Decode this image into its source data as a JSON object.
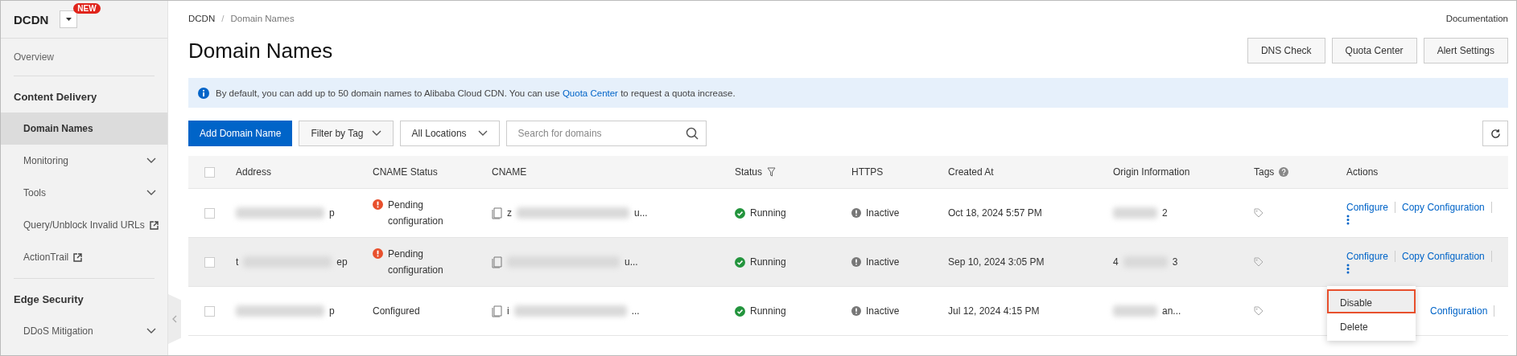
{
  "sidebar": {
    "title": "DCDN",
    "badge": "NEW",
    "sections": [
      {
        "items": [
          {
            "label": "Overview",
            "selected": false
          }
        ]
      },
      {
        "heading": "Content Delivery",
        "items": [
          {
            "label": "Domain Names",
            "selected": true
          },
          {
            "label": "Monitoring",
            "selected": false,
            "expanded": false
          },
          {
            "label": "Tools",
            "selected": false,
            "expanded": false
          },
          {
            "label": "Query/Unblock Invalid URLs",
            "selected": false,
            "external": true
          },
          {
            "label": "ActionTrail",
            "selected": false,
            "external": true
          }
        ]
      },
      {
        "heading": "Edge Security",
        "items": [
          {
            "label": "DDoS Mitigation",
            "selected": false,
            "expanded": false
          }
        ]
      }
    ]
  },
  "breadcrumb": [
    "DCDN",
    "Domain Names"
  ],
  "breadcrumb_separator": "/",
  "documentation_link": "Documentation",
  "title": "Domain Names",
  "header_buttons": [
    "DNS Check",
    "Quota Center",
    "Alert Settings"
  ],
  "notice": {
    "before": "By default, you can add up to 50 domain names to Alibaba Cloud CDN. You can use ",
    "link": "Quota Center",
    "after": " to request a quota increase."
  },
  "toolbar": {
    "add_button": "Add Domain Name",
    "tag_filter": "Filter by Tag",
    "location": "All Locations",
    "search": {
      "placeholder": "Search for domains"
    }
  },
  "table": {
    "all_checked": false,
    "columns": [
      "Address",
      "CNAME Status",
      "CNAME",
      "Status",
      "HTTPS",
      "Created At",
      "Origin Information",
      "Tags",
      "Actions"
    ],
    "rows": [
      {
        "checked": false,
        "hovered": false,
        "address": {
          "suffix": "p"
        },
        "cname_status": {
          "kind": "pending",
          "text": "Pending configuration"
        },
        "cname": {
          "prefix": "z",
          "suffix": "u..."
        },
        "status": {
          "kind": "running",
          "text": "Running"
        },
        "https": {
          "kind": "inactive",
          "text": "Inactive"
        },
        "created_at": "Oct 18, 2024 5:57 PM",
        "origin": {
          "suffix": "2"
        },
        "actions": [
          {
            "label": "Configure",
            "kind": "full"
          },
          {
            "label": "Copy Configuration",
            "kind": "full"
          }
        ],
        "more": true
      },
      {
        "checked": false,
        "hovered": true,
        "address": {
          "prefix": "t",
          "suffix": "ep"
        },
        "cname_status": {
          "kind": "pending",
          "text": "Pending configuration"
        },
        "cname": {
          "suffix": "u..."
        },
        "status": {
          "kind": "running",
          "text": "Running"
        },
        "https": {
          "kind": "inactive",
          "text": "Inactive"
        },
        "created_at": "Sep 10, 2024 3:05 PM",
        "origin": {
          "prefix": "4",
          "suffix": "3"
        },
        "actions": [
          {
            "label": "Configure",
            "kind": "full"
          },
          {
            "label": "Copy Configuration",
            "kind": "full"
          }
        ],
        "more": true
      },
      {
        "checked": false,
        "hovered": false,
        "address": {
          "suffix": "p"
        },
        "cname_status": {
          "kind": "configured",
          "text": "Configured"
        },
        "cname": {
          "prefix": "i",
          "suffix": "..."
        },
        "status": {
          "kind": "running",
          "text": "Running"
        },
        "https": {
          "kind": "inactive",
          "text": "Inactive"
        },
        "created_at": "Jul 12, 2024 4:15 PM",
        "origin": {
          "suffix": "an..."
        },
        "actions": [
          {
            "label": "Configuration",
            "kind": "covered"
          }
        ],
        "more": false
      }
    ]
  },
  "menu": [
    {
      "label": "Disable",
      "selected": true
    },
    {
      "label": "Delete",
      "selected": false
    }
  ]
}
